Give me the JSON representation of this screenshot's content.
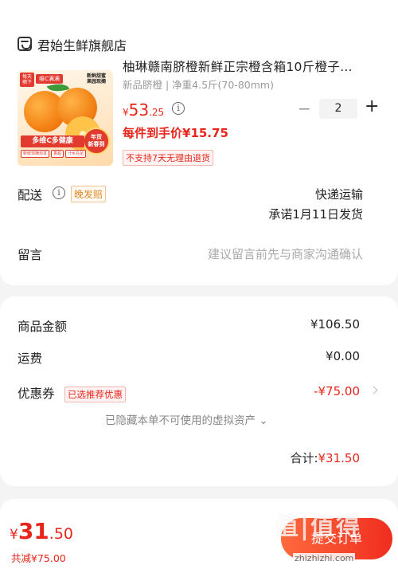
{
  "store": {
    "name": "君始生鲜旗舰店",
    "icon": "store-icon"
  },
  "product": {
    "title": "柚琳赣南脐橙新鲜正宗橙含箱10斤橙子…",
    "spec": "新品脐橙 | 净重4.5斤(70-80mm)",
    "image": {
      "tag_top_left": "每天\n摘下",
      "tag_top_left2": "维C满满",
      "tag_top_right": "新鲜甜蜜\n果园现摘",
      "banner": "多维C多健康",
      "badge": "年货\n新春到",
      "mini_tags": [
        "新鲜现摘现发",
        "香甜",
        "汁水充足"
      ]
    },
    "price_yen": "¥",
    "price_int": "53",
    "price_dec": ".25",
    "quantity": "2",
    "per_piece": "每件到手价¥15.75",
    "no_return": "不支持7天无理由退货"
  },
  "delivery": {
    "label": "配送",
    "tag": "晚发赔",
    "method": "快递运输",
    "promise": "承诺1月11日发货"
  },
  "memo": {
    "label": "留言",
    "placeholder": "建议留言前先与商家沟通确认"
  },
  "summary": {
    "goods_label": "商品金额",
    "goods_value": "¥106.50",
    "shipping_label": "运费",
    "shipping_value": "¥0.00",
    "coupon_label": "优惠券",
    "coupon_tag": "已选推荐优惠",
    "coupon_value": "-¥75.00",
    "hidden_note": "已隐藏本单不可使用的虚拟资产",
    "total_label": "合计:",
    "total_value": "¥31.50"
  },
  "footer": {
    "pay_yen": "¥",
    "pay_int": "31",
    "pay_dec": ".50",
    "saved": "共减¥75.00",
    "submit": "提交订单",
    "watermark": "值|值得",
    "watermark_url": "zhizhizhi.com"
  },
  "colors": {
    "accent": "#e8251a",
    "orange_tag": "#e08a2a",
    "background": "#f4f4f4"
  }
}
